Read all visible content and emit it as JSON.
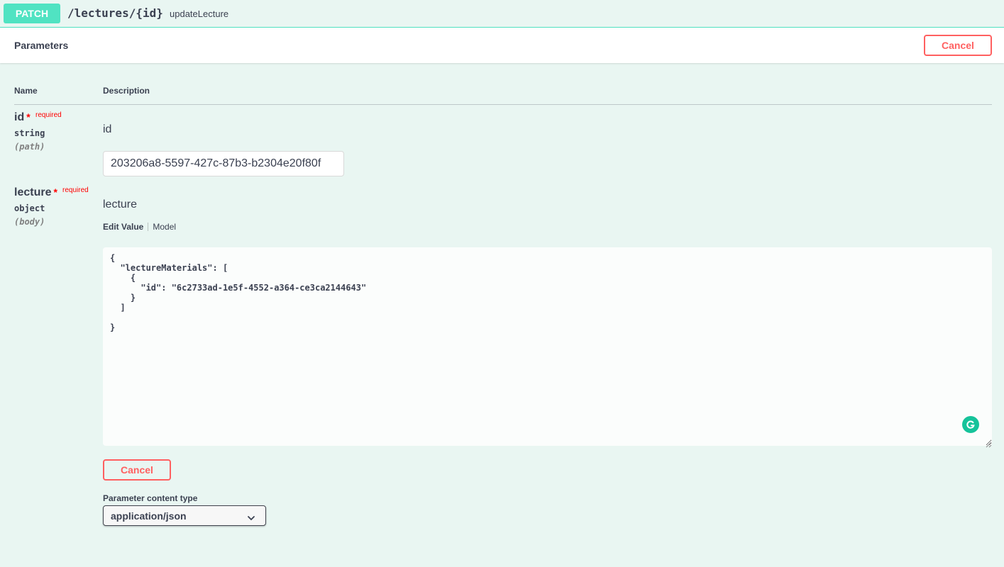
{
  "operation": {
    "method": "PATCH",
    "path": "/lectures/{id}",
    "operation_id": "updateLecture"
  },
  "parameters_section": {
    "title": "Parameters",
    "cancel_label": "Cancel"
  },
  "table": {
    "name_header": "Name",
    "description_header": "Description"
  },
  "params": [
    {
      "name": "id",
      "required_label": "required",
      "type": "string",
      "in": "(path)",
      "description": "id",
      "value": "203206a8-5597-427c-87b3-b2304e20f80f"
    },
    {
      "name": "lecture",
      "required_label": "required",
      "type": "object",
      "in": "(body)",
      "description": "lecture",
      "tabs": [
        "Edit Value",
        "Model"
      ],
      "body_value": "{\n  \"lectureMaterials\": [\n    {\n      \"id\": \"6c2733ad-1e5f-4552-a364-ce3ca2144643\"\n    }\n  ]\n\n}"
    }
  ],
  "cancel_label": "Cancel",
  "content_type": {
    "label": "Parameter content type",
    "selected": "application/json"
  },
  "colors": {
    "patch": "#50e3c2",
    "background": "#e9f6f2",
    "cancel": "#ff6060",
    "required": "#ff0000"
  },
  "icons": {
    "grammarly": "grammarly-icon",
    "chevron": "chevron-down-icon"
  }
}
